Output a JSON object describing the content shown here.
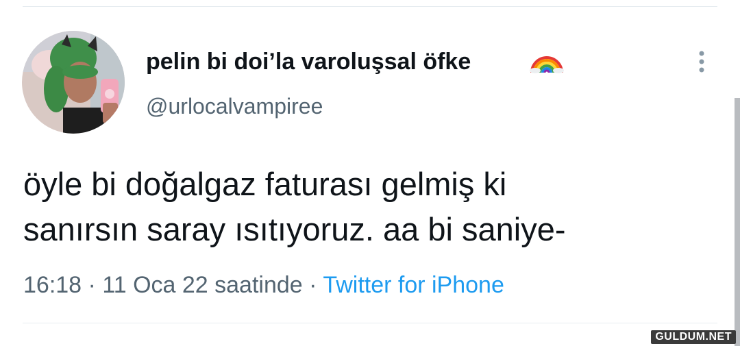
{
  "tweet": {
    "display_name": "pelin bi doi’la varoluşsal öfke",
    "name_emoji": "rainbow-icon",
    "handle": "@urlocalvampiree",
    "text_lines": [
      "öyle bi doğalgaz faturası gelmiş ki",
      "sanırsın saray ısıtıyoruz. aa bi saniye-"
    ],
    "time": "16:18",
    "separator": "·",
    "date": "11 Oca 22 saatinde",
    "source": "Twitter for iPhone"
  },
  "icons": {
    "more": "more-vertical-icon",
    "avatar": "avatar-photo"
  },
  "colors": {
    "name": "#0f1419",
    "secondary": "#536471",
    "link": "#1d9bf0",
    "divider": "#e6ecf0"
  },
  "watermark": "GULDUM.NET"
}
